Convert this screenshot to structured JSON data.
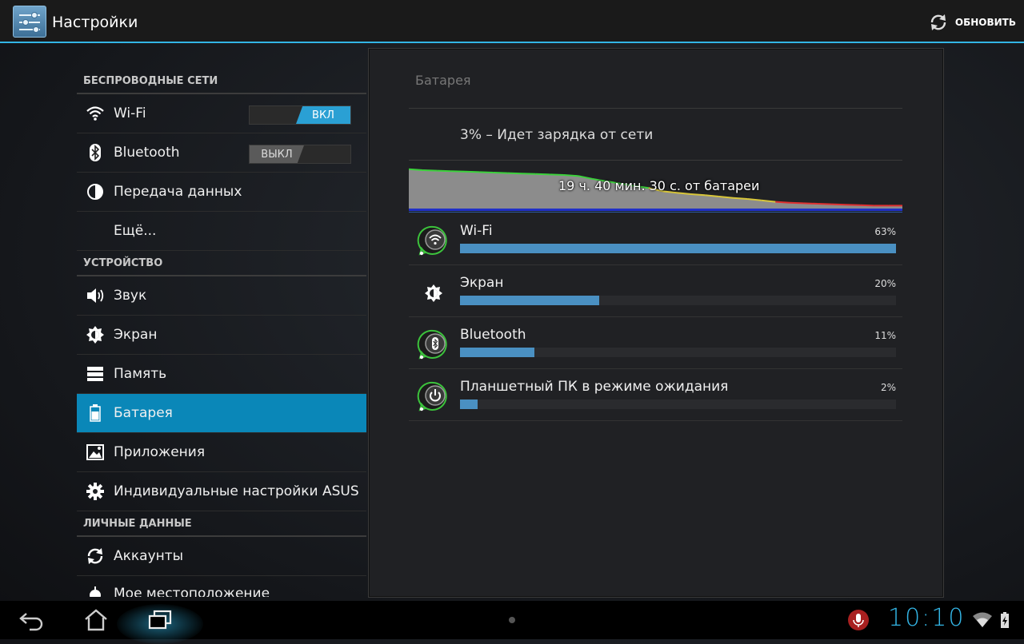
{
  "app": {
    "title": "Настройки",
    "refresh_label": "ОБНОВИТЬ"
  },
  "sections": {
    "wireless": "БЕСПРОВОДНЫЕ СЕТИ",
    "device": "УСТРОЙСТВО",
    "personal": "ЛИЧНЫЕ ДАННЫЕ"
  },
  "items": {
    "wifi": {
      "label": "Wi-Fi",
      "toggle": "ВКЛ"
    },
    "bluetooth": {
      "label": "Bluetooth",
      "toggle": "ВЫКЛ"
    },
    "data": {
      "label": "Передача данных"
    },
    "more": {
      "label": "Ещё..."
    },
    "sound": {
      "label": "Звук"
    },
    "screen": {
      "label": "Экран"
    },
    "memory": {
      "label": "Память"
    },
    "battery": {
      "label": "Батарея"
    },
    "apps": {
      "label": "Приложения"
    },
    "asus": {
      "label": "Индивидуальные настройки ASUS"
    },
    "accounts": {
      "label": "Аккаунты"
    },
    "location": {
      "label": "Мое местоположение"
    }
  },
  "battery_panel": {
    "title": "Батарея",
    "status": "3% – Идет зарядка от сети",
    "graph_label": "19 ч. 40 мин. 30 с. от батареи",
    "graph_level": [
      82,
      80,
      79,
      78,
      77,
      76,
      75,
      74,
      73,
      72,
      71,
      70,
      68,
      62,
      57,
      52,
      47,
      43,
      36,
      33,
      30,
      28,
      25,
      22,
      20,
      17,
      14,
      12,
      11,
      10,
      9,
      8,
      7,
      6,
      6,
      6
    ],
    "usage": [
      {
        "name": "Wi-Fi",
        "percent_label": "63%",
        "fraction": 1.0,
        "icon": "wifi-icon"
      },
      {
        "name": "Экран",
        "percent_label": "20%",
        "fraction": 0.32,
        "icon": "brightness-icon"
      },
      {
        "name": "Bluetooth",
        "percent_label": "11%",
        "fraction": 0.17,
        "icon": "bluetooth-icon"
      },
      {
        "name": "Планшетный ПК в режиме ожидания",
        "percent_label": "2%",
        "fraction": 0.04,
        "icon": "power-icon"
      }
    ]
  },
  "statusbar": {
    "clock": "10:10"
  },
  "colors": {
    "accent": "#33b5e5",
    "selected": "#0a87b8",
    "bar": "#4a90c2"
  }
}
